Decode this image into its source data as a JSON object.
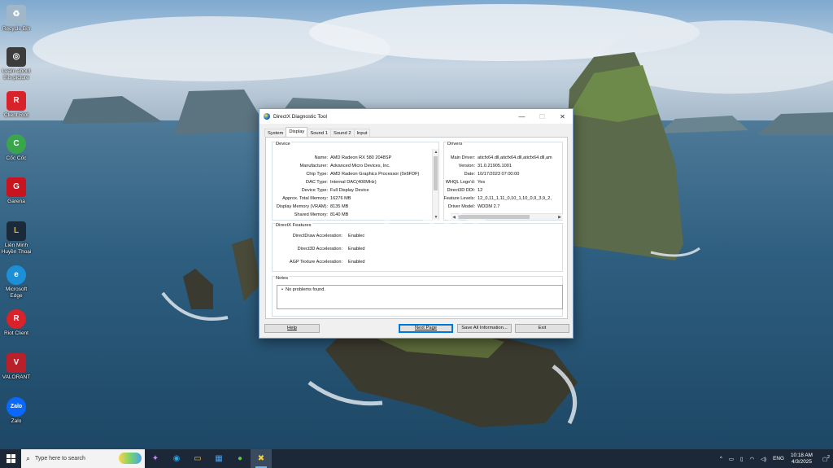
{
  "desktop_icons": [
    {
      "label": "Recycle Bin",
      "icon": "recycle-bin-icon",
      "color": "#9fb7c9"
    },
    {
      "label": "Learn about this picture",
      "icon": "camera-icon",
      "color": "#3c3c3c"
    },
    {
      "label": "Client Riot",
      "icon": "riot-icon",
      "color": "#d8232a"
    },
    {
      "label": "Cốc Cốc",
      "icon": "coccoc-icon",
      "color": "#3aa64b"
    },
    {
      "label": "Garena",
      "icon": "garena-icon",
      "color": "#c8141e"
    },
    {
      "label": "Liên Minh Huyền Thoại",
      "icon": "lol-icon",
      "color": "#1b2a3a"
    },
    {
      "label": "Microsoft Edge",
      "icon": "edge-icon",
      "color": "#1d8fd6"
    },
    {
      "label": "Riot Client",
      "icon": "riot-client-icon",
      "color": "#d8232a"
    },
    {
      "label": "VALORANT",
      "icon": "valorant-icon",
      "color": "#b8202c"
    },
    {
      "label": "Zalo",
      "icon": "zalo-icon",
      "color": "#0a68ff"
    }
  ],
  "window": {
    "title": "DirectX Diagnostic Tool",
    "minimize": "—",
    "maximize": "☐",
    "close": "✕",
    "tabs": [
      {
        "label": "System",
        "active": false
      },
      {
        "label": "Display",
        "active": true
      },
      {
        "label": "Sound 1",
        "active": false
      },
      {
        "label": "Sound 2",
        "active": false
      },
      {
        "label": "Input",
        "active": false
      }
    ],
    "device": {
      "title": "Device",
      "rows": [
        {
          "label": "Name:",
          "value": "AMD Radeon RX 580 2048SP"
        },
        {
          "label": "Manufacturer:",
          "value": "Advanced Micro Devices, Inc."
        },
        {
          "label": "Chip Type:",
          "value": "AMD Radeon Graphics Processor (0x6FDF)"
        },
        {
          "label": "DAC Type:",
          "value": "Internal DAC(400MHz)"
        },
        {
          "label": "Device Type:",
          "value": "Full Display Device"
        },
        {
          "label": "Approx. Total Memory:",
          "value": "16276 MB"
        },
        {
          "label": "Display Memory (VRAM):",
          "value": "8135 MB"
        },
        {
          "label": "Shared Memory:",
          "value": "8140 MB"
        }
      ]
    },
    "drivers": {
      "title": "Drivers",
      "rows": [
        {
          "label": "Main Driver:",
          "value": "aticfx64.dll,aticfx64.dll,aticfx64.dll,am"
        },
        {
          "label": "Version:",
          "value": "31.0.21905.1001"
        },
        {
          "label": "Date:",
          "value": "10/17/2023 07:00:00"
        },
        {
          "label": "WHQL Logo'd:",
          "value": "Yes"
        },
        {
          "label": "Direct3D DDI:",
          "value": "12"
        },
        {
          "label": "Feature Levels:",
          "value": "12_0,11_1,11_0,10_1,10_0,9_3,9_2,"
        },
        {
          "label": "Driver Model:",
          "value": "WDDM 2.7"
        }
      ]
    },
    "features": {
      "title": "DirectX Features",
      "rows": [
        {
          "label": "DirectDraw Acceleration:",
          "value": "Enabled"
        },
        {
          "label": "Direct3D Acceleration:",
          "value": "Enabled"
        },
        {
          "label": "AGP Texture Acceleration:",
          "value": "Enabled"
        }
      ]
    },
    "notes": {
      "title": "Notes",
      "items": [
        "No problems found."
      ]
    },
    "buttons": {
      "help": "Help",
      "next_page": "Next Page",
      "save_all": "Save All Information...",
      "exit": "Exit"
    }
  },
  "watermark": "chợTỐT",
  "taskbar": {
    "search_placeholder": "Type here to search",
    "apps": [
      {
        "name": "copilot-icon",
        "glyph": "✦",
        "color": "#c58af0",
        "active": false
      },
      {
        "name": "edge-taskbar-icon",
        "glyph": "◉",
        "color": "#2aa4e8",
        "active": false
      },
      {
        "name": "file-explorer-icon",
        "glyph": "▭",
        "color": "#f3c23b",
        "active": false
      },
      {
        "name": "store-icon",
        "glyph": "▦",
        "color": "#4aa3e8",
        "active": false
      },
      {
        "name": "coccoc-taskbar-icon",
        "glyph": "●",
        "color": "#5cc25a",
        "active": false
      },
      {
        "name": "dxdiag-taskbar-icon",
        "glyph": "✖",
        "color": "#f2d33a",
        "active": true
      }
    ],
    "tray": {
      "chevron": "^",
      "language": "ENG",
      "time": "10:18 AM",
      "date": "4/3/2025",
      "notifications": "2"
    }
  }
}
